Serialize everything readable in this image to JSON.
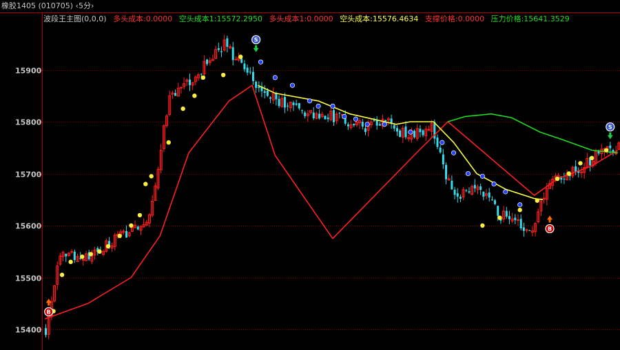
{
  "window": {
    "title": "橡胶1405 (010705) ‹5分›"
  },
  "legend": {
    "indicator": "波段王主图(0,0,0)",
    "items": [
      {
        "label": "多头成本:0.0000",
        "color": "#ff3232"
      },
      {
        "label": "空头成本1:15572.2950",
        "color": "#22dd22"
      },
      {
        "label": "多头成本1:0.0000",
        "color": "#ff3232"
      },
      {
        "label": "空头成本:15576.4634",
        "color": "#ffff44"
      },
      {
        "label": "支撑价格:0.0000",
        "color": "#ff3232"
      },
      {
        "label": "压力价格:15641.3529",
        "color": "#22dd22"
      }
    ]
  },
  "colors": {
    "up": "#ff2020",
    "down": "#33ddee",
    "grid": "#8a0000",
    "axis": "#b00000",
    "axis_text": "#c8c8c8",
    "long_cost": "#ff2020",
    "short_cost_yellow": "#ffff44",
    "short_cost_green": "#22dd22",
    "dot_yellow": "#ffee44",
    "dot_blue": "#2244ff"
  },
  "chart_data": {
    "type": "candlestick",
    "ylim": [
      15390,
      15980
    ],
    "y_ticks": [
      15400,
      15500,
      15600,
      15700,
      15800,
      15900
    ],
    "grid": true,
    "bars_count": 200,
    "segments": [
      [
        0,
        15400
      ],
      [
        5,
        15540
      ],
      [
        15,
        15545
      ],
      [
        22,
        15565
      ],
      [
        30,
        15590
      ],
      [
        36,
        15620
      ],
      [
        43,
        15850
      ],
      [
        52,
        15890
      ],
      [
        62,
        15950
      ],
      [
        72,
        15880
      ],
      [
        80,
        15840
      ],
      [
        90,
        15820
      ],
      [
        100,
        15810
      ],
      [
        110,
        15790
      ],
      [
        118,
        15800
      ],
      [
        126,
        15770
      ],
      [
        134,
        15790
      ],
      [
        137,
        15730
      ],
      [
        142,
        15655
      ],
      [
        150,
        15670
      ],
      [
        158,
        15620
      ],
      [
        165,
        15600
      ],
      [
        170,
        15600
      ],
      [
        175,
        15690
      ],
      [
        185,
        15710
      ],
      [
        193,
        15740
      ],
      [
        199,
        15750
      ]
    ],
    "lines": {
      "long_cost": [
        [
          0,
          15420
        ],
        [
          15,
          15450
        ],
        [
          30,
          15500
        ],
        [
          40,
          15580
        ],
        [
          50,
          15740
        ],
        [
          64,
          15840
        ],
        [
          72,
          15870
        ],
        [
          80,
          15735
        ],
        [
          100,
          15575
        ],
        [
          115,
          15660
        ],
        [
          130,
          15745
        ],
        [
          140,
          15800
        ],
        [
          170,
          15658
        ],
        [
          178,
          15690
        ],
        [
          190,
          15715
        ],
        [
          199,
          15745
        ]
      ],
      "short_cost_yellow": [
        [
          74,
          15870
        ],
        [
          80,
          15855
        ],
        [
          95,
          15840
        ],
        [
          106,
          15815
        ],
        [
          122,
          15795
        ],
        [
          127,
          15800
        ],
        [
          135,
          15800
        ],
        [
          142,
          15760
        ],
        [
          150,
          15700
        ],
        [
          160,
          15670
        ],
        [
          170,
          15652
        ],
        [
          173,
          15650
        ]
      ],
      "short_cost_green": [
        [
          140,
          15800
        ],
        [
          146,
          15810
        ],
        [
          155,
          15815
        ],
        [
          162,
          15808
        ],
        [
          172,
          15780
        ],
        [
          180,
          15765
        ],
        [
          190,
          15745
        ],
        [
          199,
          15740
        ]
      ]
    },
    "dots_yellow": [
      [
        3,
        15435
      ],
      [
        6,
        15505
      ],
      [
        9,
        15530
      ],
      [
        13,
        15540
      ],
      [
        16,
        15545
      ],
      [
        19,
        15550
      ],
      [
        22,
        15560
      ],
      [
        26,
        15580
      ],
      [
        30,
        15600
      ],
      [
        33,
        15620
      ],
      [
        35,
        15680
      ],
      [
        37,
        15695
      ],
      [
        43,
        15760
      ],
      [
        48,
        15825
      ],
      [
        52,
        15850
      ],
      [
        55,
        15885
      ],
      [
        62,
        15890
      ],
      [
        68,
        15925
      ],
      [
        152,
        15600
      ],
      [
        158,
        15615
      ],
      [
        165,
        15630
      ],
      [
        171,
        15648
      ],
      [
        178,
        15690
      ],
      [
        182,
        15700
      ],
      [
        186,
        15720
      ],
      [
        190,
        15730
      ],
      [
        195,
        15745
      ]
    ],
    "dots_blue": [
      [
        75,
        15915
      ],
      [
        80,
        15885
      ],
      [
        86,
        15870
      ],
      [
        92,
        15840
      ],
      [
        95,
        15830
      ],
      [
        100,
        15830
      ],
      [
        104,
        15810
      ],
      [
        108,
        15805
      ],
      [
        112,
        15795
      ],
      [
        118,
        15795
      ],
      [
        127,
        15780
      ],
      [
        138,
        15760
      ],
      [
        142,
        15740
      ],
      [
        147,
        15700
      ],
      [
        152,
        15695
      ],
      [
        156,
        15680
      ],
      [
        160,
        15665
      ],
      [
        165,
        15640
      ]
    ],
    "markers": [
      {
        "type": "buy",
        "bar": 1,
        "price": 15430,
        "label": "B"
      },
      {
        "type": "sell",
        "bar": 73,
        "price": 15958,
        "label": "S"
      },
      {
        "type": "buy",
        "bar": 175,
        "price": 15590,
        "label": "B"
      },
      {
        "type": "sell",
        "bar": 196,
        "price": 15790,
        "label": "S"
      }
    ]
  }
}
